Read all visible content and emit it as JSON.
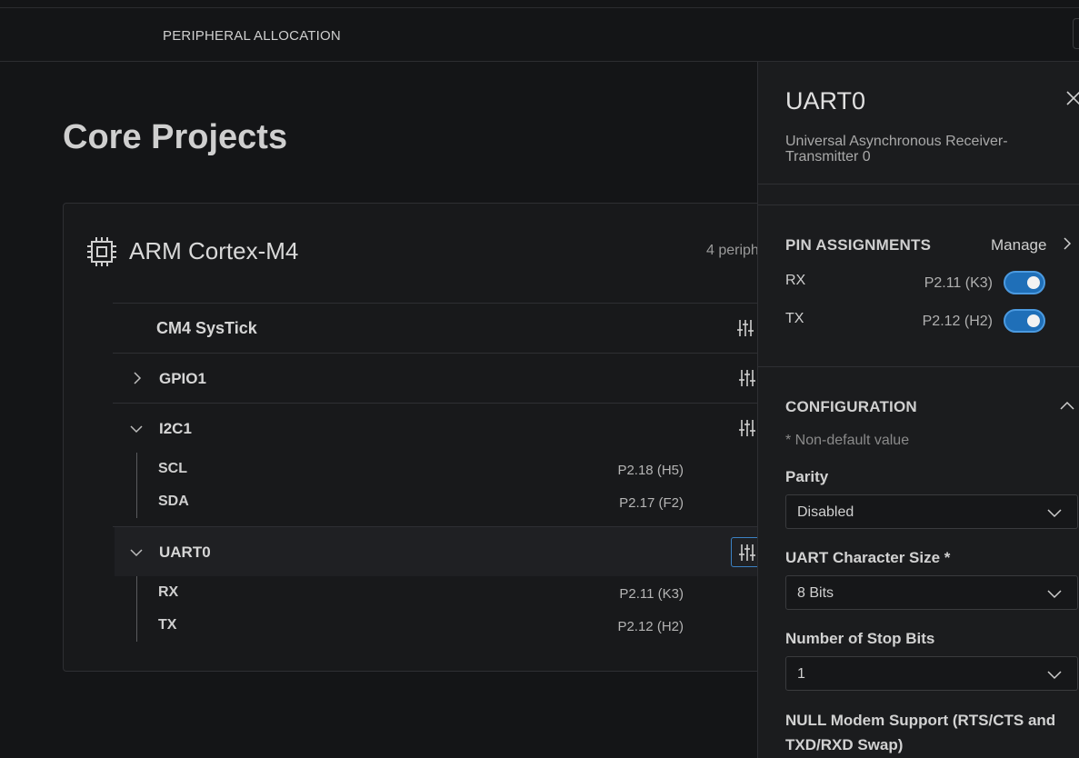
{
  "header": {
    "nav_title": "PERIPHERAL ALLOCATION"
  },
  "page": {
    "title": "Core Projects"
  },
  "core": {
    "name": "ARM Cortex-M4",
    "peripheral_count_text": "4 periph",
    "peripherals": [
      {
        "name": "CM4 SysTick"
      },
      {
        "name": "GPIO1"
      },
      {
        "name": "I2C1",
        "pins": [
          {
            "name": "SCL",
            "value": "P2.18 (H5)"
          },
          {
            "name": "SDA",
            "value": "P2.17 (F2)"
          }
        ]
      },
      {
        "name": "UART0",
        "pins": [
          {
            "name": "RX",
            "value": "P2.11 (K3)"
          },
          {
            "name": "TX",
            "value": "P2.12 (H2)"
          }
        ]
      }
    ]
  },
  "panel": {
    "title": "UART0",
    "subtitle": "Universal Asynchronous Receiver-Transmitter 0",
    "pin_assignments": {
      "heading": "PIN ASSIGNMENTS",
      "manage_label": "Manage",
      "pins": [
        {
          "name": "RX",
          "value": "P2.11 (K3)",
          "enabled": true
        },
        {
          "name": "TX",
          "value": "P2.12 (H2)",
          "enabled": true
        }
      ]
    },
    "configuration": {
      "heading": "CONFIGURATION",
      "nondefault_note": "* Non-default value",
      "fields": [
        {
          "label": "Parity",
          "value": "Disabled"
        },
        {
          "label": "UART Character Size *",
          "value": "8 Bits"
        },
        {
          "label": "Number of Stop Bits",
          "value": "1"
        }
      ],
      "null_modem_label": "NULL Modem Support (RTS/CTS and TXD/RXD Swap)"
    }
  },
  "colors": {
    "background": "#141517",
    "panel": "#1b1c1e",
    "accent": "#1f6fb8"
  }
}
